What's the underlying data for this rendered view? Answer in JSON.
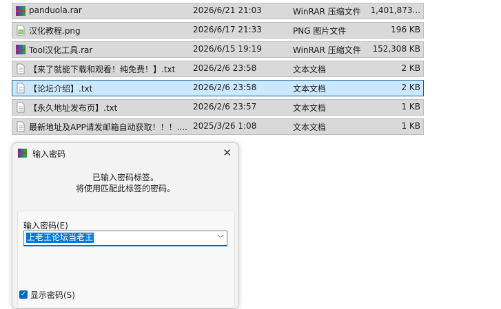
{
  "files": [
    {
      "name": "panduola.rar",
      "date": "2026/6/21 21:03",
      "type": "WinRAR 压缩文件",
      "size": "1,401,873...",
      "icon": "winrar-archive-icon",
      "selected": false
    },
    {
      "name": "汉化教程.png",
      "date": "2026/6/17 21:33",
      "type": "PNG 图片文件",
      "size": "196 KB",
      "icon": "png-image-icon",
      "selected": false
    },
    {
      "name": "Tool汉化工具.rar",
      "date": "2026/6/15 19:19",
      "type": "WinRAR 压缩文件",
      "size": "152,308 KB",
      "icon": "winrar-archive-icon",
      "selected": false
    },
    {
      "name": "【来了就能下载和观看！纯免费！】.txt",
      "date": "2026/2/6 23:58",
      "type": "文本文档",
      "size": "2 KB",
      "icon": "text-document-icon",
      "selected": false
    },
    {
      "name": "【论坛介绍】.txt",
      "date": "2026/2/6 23:58",
      "type": "文本文档",
      "size": "2 KB",
      "icon": "text-document-icon",
      "selected": true
    },
    {
      "name": "【永久地址发布页】.txt",
      "date": "2026/2/6 23:57",
      "type": "文本文档",
      "size": "1 KB",
      "icon": "text-document-icon",
      "selected": false
    },
    {
      "name": "最新地址及APP请发邮箱自动获取！！！....",
      "date": "2025/3/26 1:08",
      "type": "文本文档",
      "size": "1 KB",
      "icon": "text-document-icon",
      "selected": false
    }
  ],
  "dialog": {
    "title": "输入密码",
    "info_line1": "已输入密码标签。",
    "info_line2": "将使用匹配此标签的密码。",
    "password_label": "输入密码(E)",
    "password_value": "上老王论坛当老王",
    "show_password_label": "显示密码(S)",
    "close_glyph": "✕",
    "show_password_checked": true
  },
  "colors": {
    "row_bg": "#d9d9d9",
    "selected_bg": "#cce8ff",
    "selected_border": "#0f5a8a",
    "accent": "#0067c0"
  }
}
